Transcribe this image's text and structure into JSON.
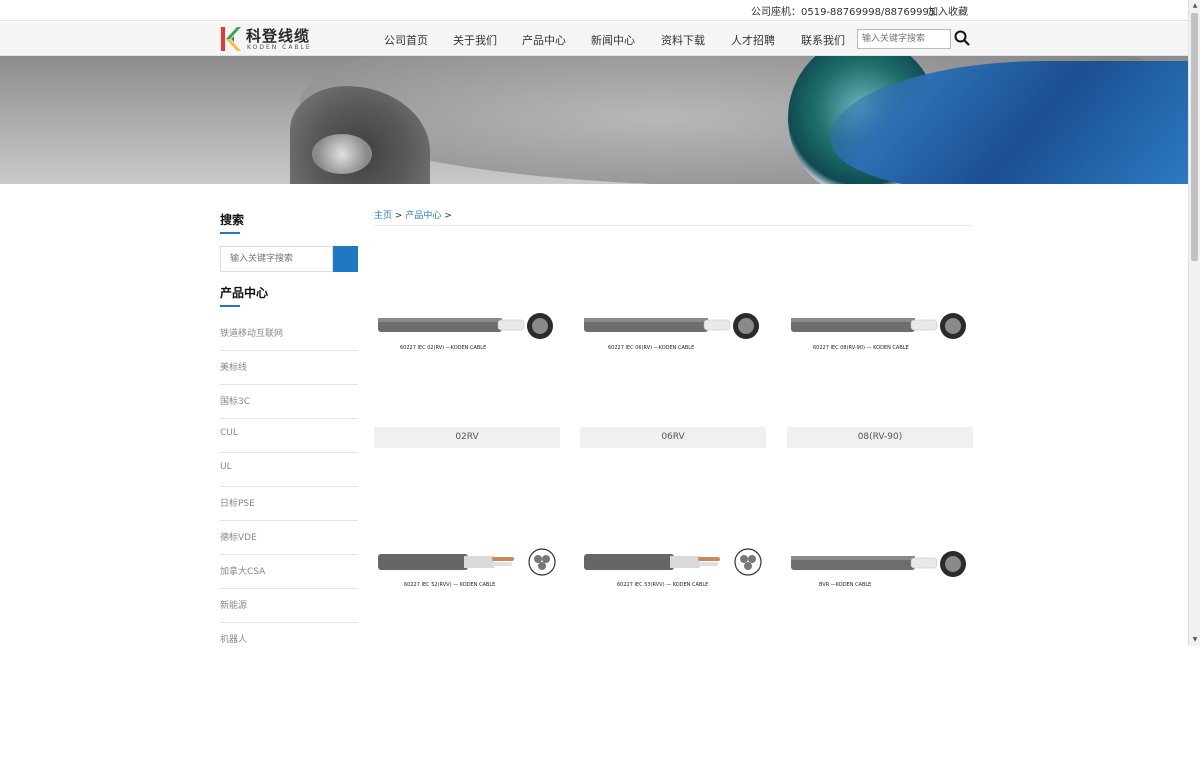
{
  "topbar": {
    "phone": "公司座机：0519-88769998/88769995",
    "favorite": "加入收藏"
  },
  "logo": {
    "name_cn": "科登线缆",
    "name_en": "KODEN CABLE"
  },
  "nav": {
    "items": [
      "公司首页",
      "关于我们",
      "产品中心",
      "新闻中心",
      "资料下载",
      "人才招聘",
      "联系我们"
    ],
    "search_placeholder": "输入关键字搜索"
  },
  "sidebar": {
    "search_title": "搜索",
    "search_placeholder": "输入关键字搜索",
    "categories_title": "产品中心",
    "categories": [
      "铁道移动互联网",
      "美标线",
      "国标3C",
      "CUL",
      "UL",
      "日标PSE",
      "德标VDE",
      "加拿大CSA",
      "新能源",
      "机器人"
    ]
  },
  "breadcrumb": {
    "home": "主页",
    "sep": ">",
    "current": "产品中心"
  },
  "products": [
    {
      "caption": "02RV",
      "spec": "60227 IEC 02(RV)  —KODEN CABLE",
      "type": "single"
    },
    {
      "caption": "06RV",
      "spec": "60227 IEC 06(RV)  —KODEN CABLE",
      "type": "single"
    },
    {
      "caption": "08(RV-90)",
      "spec": "60227 IEC 08(RV-90) —  KODEN CABLE",
      "type": "single"
    },
    {
      "caption": "",
      "spec": "60227 IEC 52(RVV) —   KODEN CABLE",
      "type": "multi"
    },
    {
      "caption": "",
      "spec": "60227 IEC 53(RVV) — KODEN CABLE",
      "type": "multi"
    },
    {
      "caption": "",
      "spec": "BVR   —KODEN CABLE",
      "type": "single"
    }
  ],
  "colors": {
    "accent": "#1f78c1",
    "caption_bg": "#f0f0f0"
  }
}
